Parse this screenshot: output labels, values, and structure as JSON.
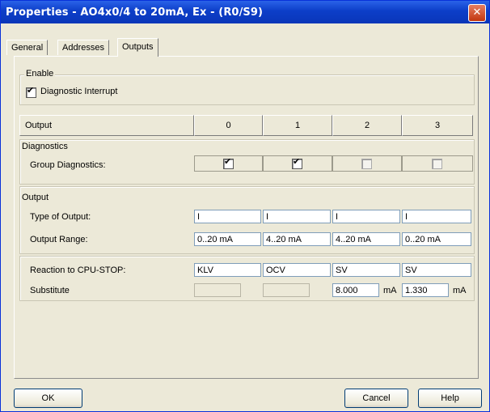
{
  "window": {
    "title": "Properties - AO4x0/4 to 20mA, Ex - (R0/S9)",
    "close_glyph": "✕"
  },
  "tabs": [
    {
      "label": "General"
    },
    {
      "label": "Addresses"
    },
    {
      "label": "Outputs",
      "active": true
    }
  ],
  "enable": {
    "group_label": "Enable",
    "diagnostic_interrupt": {
      "label": "Diagnostic Interrupt",
      "checked": true
    }
  },
  "table": {
    "header_label": "Output",
    "channels": [
      "0",
      "1",
      "2",
      "3"
    ]
  },
  "diagnostics": {
    "section_label": "Diagnostics",
    "group_diagnostics": {
      "label": "Group Diagnostics:",
      "values": [
        true,
        true,
        false,
        false
      ]
    }
  },
  "output": {
    "section_label": "Output",
    "type_of_output": {
      "label": "Type of Output:",
      "values": [
        "I",
        "I",
        "I",
        "I"
      ]
    },
    "output_range": {
      "label": "Output Range:",
      "values": [
        "0..20 mA",
        "4..20 mA",
        "4..20 mA",
        "0..20 mA"
      ]
    }
  },
  "cpu_stop": {
    "reaction": {
      "label": "Reaction to CPU-STOP:",
      "values": [
        "KLV",
        "OCV",
        "SV",
        "SV"
      ]
    },
    "substitute": {
      "label": "Substitute",
      "values": [
        "",
        "",
        "8.000",
        "1.330"
      ],
      "unit": "mA"
    }
  },
  "buttons": {
    "ok": "OK",
    "cancel": "Cancel",
    "help": "Help"
  },
  "check_glyph": "✔"
}
